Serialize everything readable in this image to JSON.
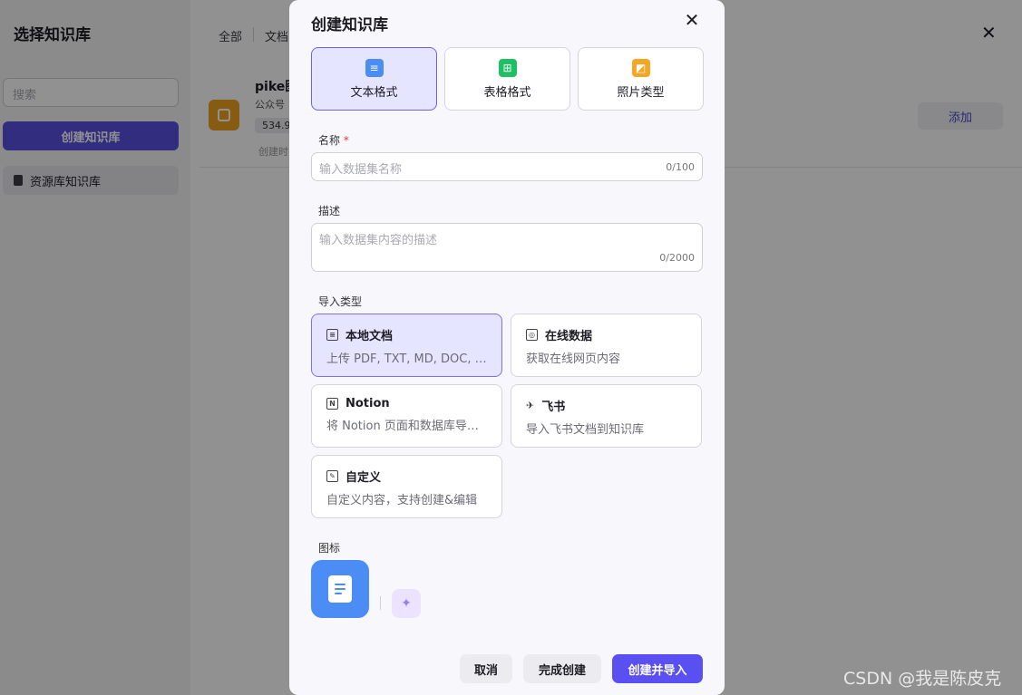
{
  "background": {
    "title": "选择知识库",
    "search_placeholder": "搜索",
    "create_button": "创建知识库",
    "resource_item": "资源库知识库",
    "tabs": [
      "全部",
      "文档"
    ],
    "item": {
      "name": "pike图",
      "sub": "公众号",
      "size": "534.9",
      "time": "创建时"
    },
    "add_button": "添加"
  },
  "modal": {
    "title": "创建知识库",
    "formats": [
      {
        "label": "文本格式",
        "icon": "doc-icon",
        "color": "#4b8cf5",
        "selected": true
      },
      {
        "label": "表格格式",
        "icon": "table-icon",
        "color": "#1fbf66",
        "selected": false
      },
      {
        "label": "照片类型",
        "icon": "image-icon",
        "color": "#f5a623",
        "selected": false
      }
    ],
    "name_label": "名称",
    "required_mark": "*",
    "name_placeholder": "输入数据集名称",
    "name_count": "0/100",
    "desc_label": "描述",
    "desc_placeholder": "输入数据集内容的描述",
    "desc_count": "0/2000",
    "import_label": "导入类型",
    "import_types": [
      {
        "title": "本地文档",
        "desc": "上传 PDF, TXT, MD, DOC, …",
        "selected": true
      },
      {
        "title": "在线数据",
        "desc": "获取在线网页内容",
        "selected": false
      },
      {
        "title": "Notion",
        "desc": "将 Notion 页面和数据库导…",
        "selected": false
      },
      {
        "title": "飞书",
        "desc": "导入飞书文档到知识库",
        "selected": false
      },
      {
        "title": "自定义",
        "desc": "自定义内容，支持创建&编辑",
        "selected": false
      }
    ],
    "icon_label": "图标",
    "buttons": {
      "cancel": "取消",
      "finish": "完成创建",
      "create": "创建并导入"
    }
  },
  "watermark": "CSDN @我是陈皮克"
}
